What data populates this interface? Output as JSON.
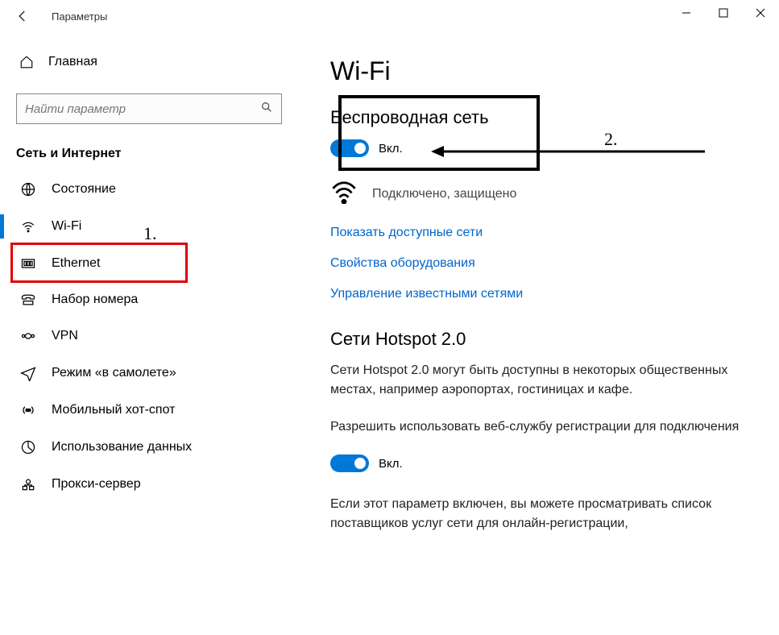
{
  "window": {
    "title": "Параметры"
  },
  "sidebar": {
    "home": "Главная",
    "search_placeholder": "Найти параметр",
    "category": "Сеть и Интернет",
    "items": [
      {
        "label": "Состояние",
        "icon": "globe-icon"
      },
      {
        "label": "Wi-Fi",
        "icon": "wifi-icon"
      },
      {
        "label": "Ethernet",
        "icon": "ethernet-icon"
      },
      {
        "label": "Набор номера",
        "icon": "dialup-icon"
      },
      {
        "label": "VPN",
        "icon": "vpn-icon"
      },
      {
        "label": "Режим «в самолете»",
        "icon": "airplane-icon"
      },
      {
        "label": "Мобильный хот-спот",
        "icon": "hotspot-icon"
      },
      {
        "label": "Использование данных",
        "icon": "data-usage-icon"
      },
      {
        "label": "Прокси-сервер",
        "icon": "proxy-icon"
      }
    ]
  },
  "main": {
    "title": "Wi-Fi",
    "wireless_heading": "Беспроводная сеть",
    "toggle_state": "Вкл.",
    "status": "Подключено, защищено",
    "links": [
      "Показать доступные сети",
      "Свойства оборудования",
      "Управление известными сетями"
    ],
    "hotspot": {
      "heading": "Сети Hotspot 2.0",
      "desc": "Сети Hotspot 2.0 могут быть доступны в некоторых общественных местах, например аэропортах, гостиницах и кафе.",
      "allow": "Разрешить использовать веб-службу регистрации для подключения",
      "toggle_state": "Вкл.",
      "note": "Если этот параметр включен, вы можете просматривать список поставщиков услуг сети для онлайн-регистрации,"
    }
  },
  "annotations": {
    "label1": "1.",
    "label2": "2."
  }
}
